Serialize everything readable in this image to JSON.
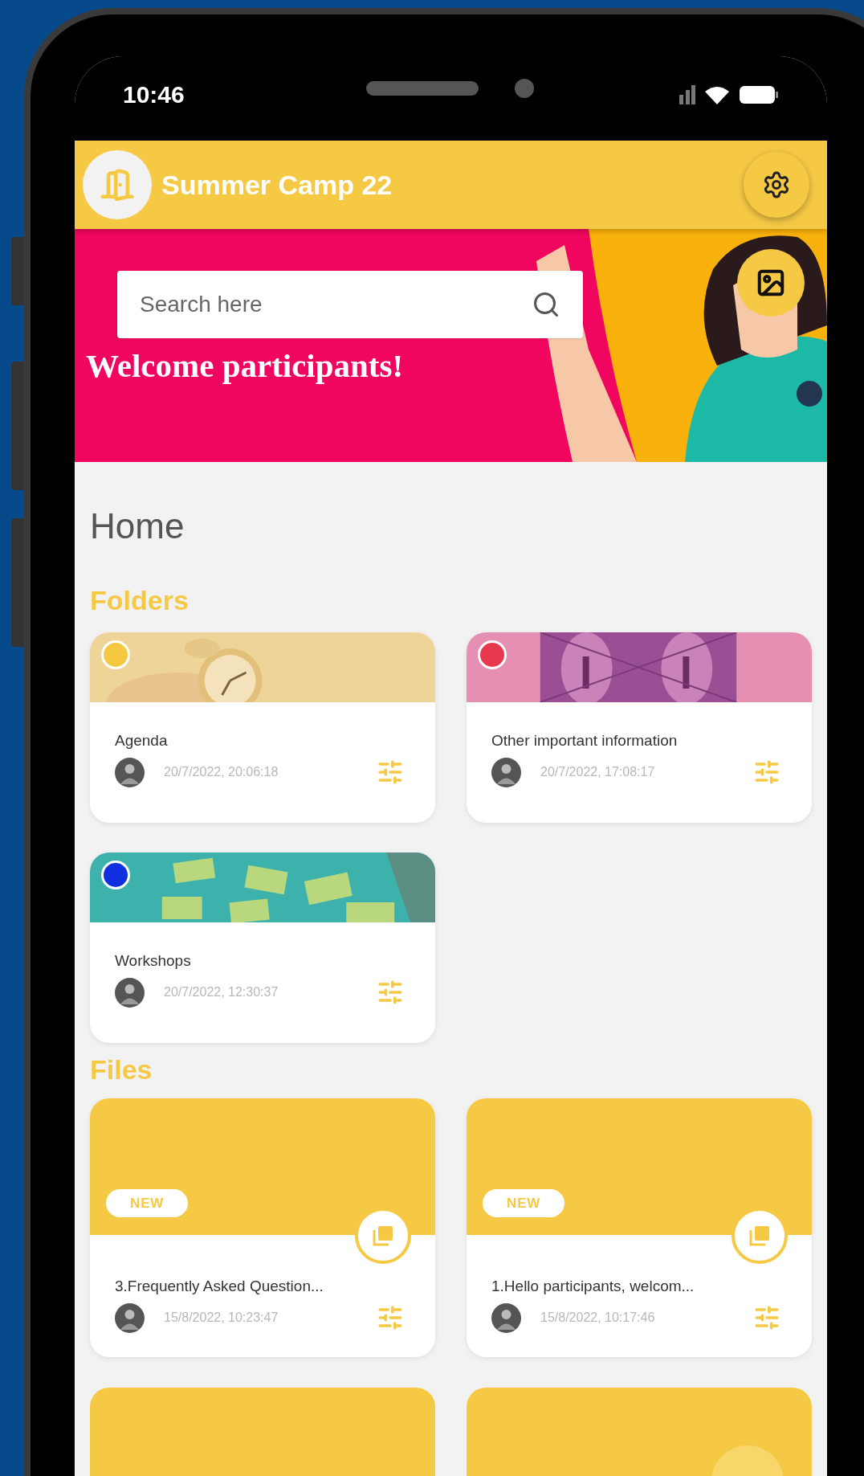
{
  "status_bar": {
    "time": "10:46"
  },
  "header": {
    "title": "Summer Camp 22"
  },
  "banner": {
    "search": {
      "placeholder": "Search here"
    },
    "headline": "Welcome participants!"
  },
  "page_title": "Home",
  "folders": {
    "heading": "Folders",
    "items": [
      {
        "name": "Agenda",
        "color": "#f5c842",
        "date": "20/7/2022, 20:06:18"
      },
      {
        "name": "Other important information",
        "color": "#e8384f",
        "date": "20/7/2022, 17:08:17"
      },
      {
        "name": "Workshops",
        "color": "#1030e0",
        "date": "20/7/2022, 12:30:37"
      }
    ]
  },
  "files": {
    "heading": "Files",
    "items": [
      {
        "name": "3.Frequently Asked Question...",
        "badge": "NEW",
        "date": "15/8/2022, 10:23:47"
      },
      {
        "name": "1.Hello participants, welcom...",
        "badge": "NEW",
        "date": "15/8/2022, 10:17:46"
      }
    ]
  }
}
